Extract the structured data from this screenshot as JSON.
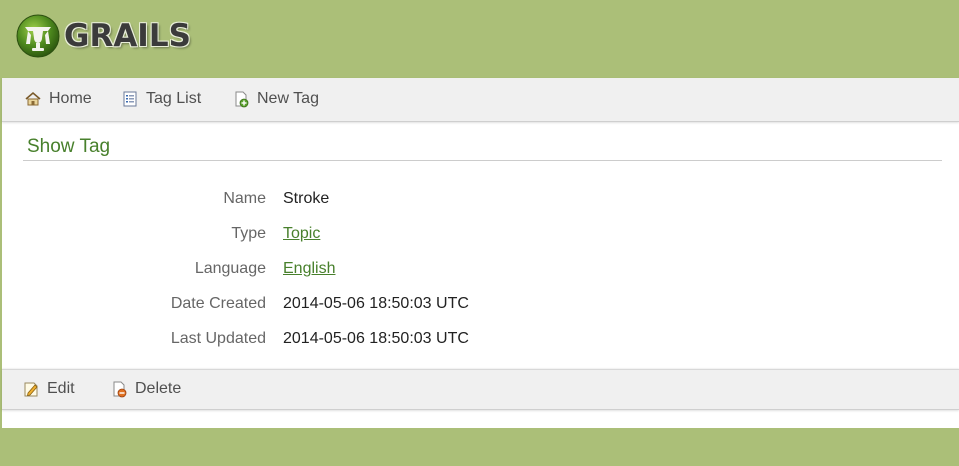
{
  "header": {
    "logo_text": "GRAILS"
  },
  "nav": {
    "home_label": "Home",
    "list_label": "Tag List",
    "new_label": "New Tag"
  },
  "page": {
    "title": "Show Tag"
  },
  "fields": [
    {
      "label": "Name",
      "value": "Stroke"
    },
    {
      "label": "Type",
      "value": "Topic"
    },
    {
      "label": "Language",
      "value": "English"
    },
    {
      "label": "Date Created",
      "value": "2014-05-06 18:50:03 UTC"
    },
    {
      "label": "Last Updated",
      "value": "2014-05-06 18:50:03 UTC"
    }
  ],
  "buttons": {
    "edit_label": "Edit",
    "delete_label": "Delete"
  },
  "colors": {
    "brand_green": "#abbf78",
    "link_green": "#48802c"
  }
}
